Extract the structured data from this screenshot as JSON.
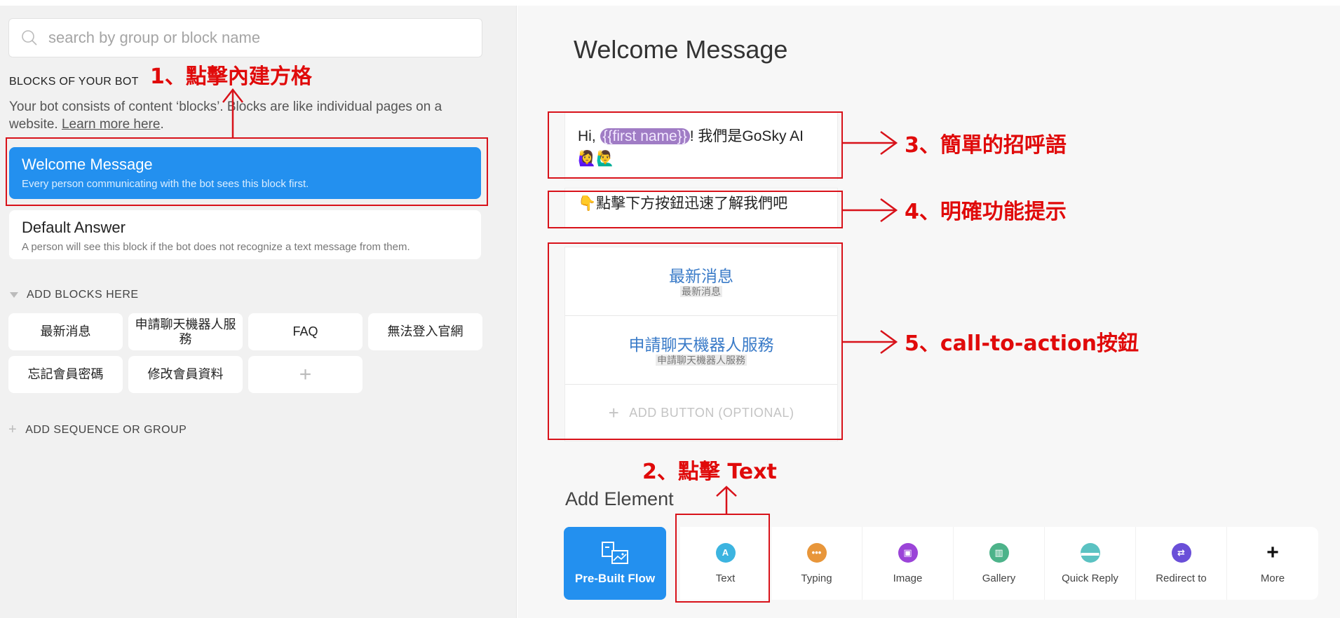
{
  "sidebar": {
    "search_placeholder": "search by group or block name",
    "section_title": "BLOCKS OF YOUR BOT",
    "description": "Your bot consists of content ‘blocks’. Blocks are like individual pages on a website. ",
    "learn_more": "Learn more here",
    "learn_more_suffix": ".",
    "blocks": [
      {
        "name": "Welcome Message",
        "desc": "Every person communicating with the bot sees this block first."
      },
      {
        "name": "Default Answer",
        "desc": "A person will see this block if the bot does not recognize a text message from them."
      }
    ],
    "add_blocks_title": "ADD BLOCKS HERE",
    "grid_items": [
      "最新消息",
      "申請聊天機器人服務",
      "FAQ",
      "無法登入官網",
      "忘記會員密碼",
      "修改會員資料"
    ],
    "grid_add": "+",
    "add_sequence": "ADD SEQUENCE OR GROUP"
  },
  "main": {
    "title": "Welcome Message",
    "message1": {
      "prefix": "Hi, ",
      "attribute": "{{first name}}",
      "suffix": "! 我們是GoSky AI 🙋‍♀️🙋‍♂️"
    },
    "message2": "👇點擊下方按鈕迅速了解我們吧",
    "buttons": [
      {
        "title": "最新消息",
        "subtitle": "最新消息"
      },
      {
        "title": "申請聊天機器人服務",
        "subtitle": "申請聊天機器人服務"
      }
    ],
    "add_button": "ADD BUTTON (OPTIONAL)",
    "add_element_title": "Add Element",
    "prebuilt_label": "Pre-Built Flow",
    "elements": [
      {
        "label": "Text",
        "icon": "text-icon",
        "glyph": "A",
        "color": "#3cb4e0"
      },
      {
        "label": "Typing",
        "icon": "typing-icon",
        "glyph": "•••",
        "color": "#e8963a"
      },
      {
        "label": "Image",
        "icon": "image-icon",
        "glyph": "▣",
        "color": "#9b44d8"
      },
      {
        "label": "Gallery",
        "icon": "gallery-icon",
        "glyph": "▥",
        "color": "#4db38a"
      },
      {
        "label": "Quick Reply",
        "icon": "quick-reply-icon",
        "glyph": "▬▬",
        "color": "#5bc2c2"
      },
      {
        "label": "Redirect to",
        "icon": "redirect-icon",
        "glyph": "⇄",
        "color": "#6a4fd8"
      },
      {
        "label": "More",
        "icon": "plus-icon",
        "glyph": "+",
        "color": ""
      }
    ]
  },
  "annotations": {
    "step1": "1、點擊內建方格",
    "step2": "2、點擊 Text",
    "step3": "3、簡單的招呼語",
    "step4": "4、明確功能提示",
    "step5": "5、call-to-action按鈕",
    "color": "#e00a0a"
  }
}
